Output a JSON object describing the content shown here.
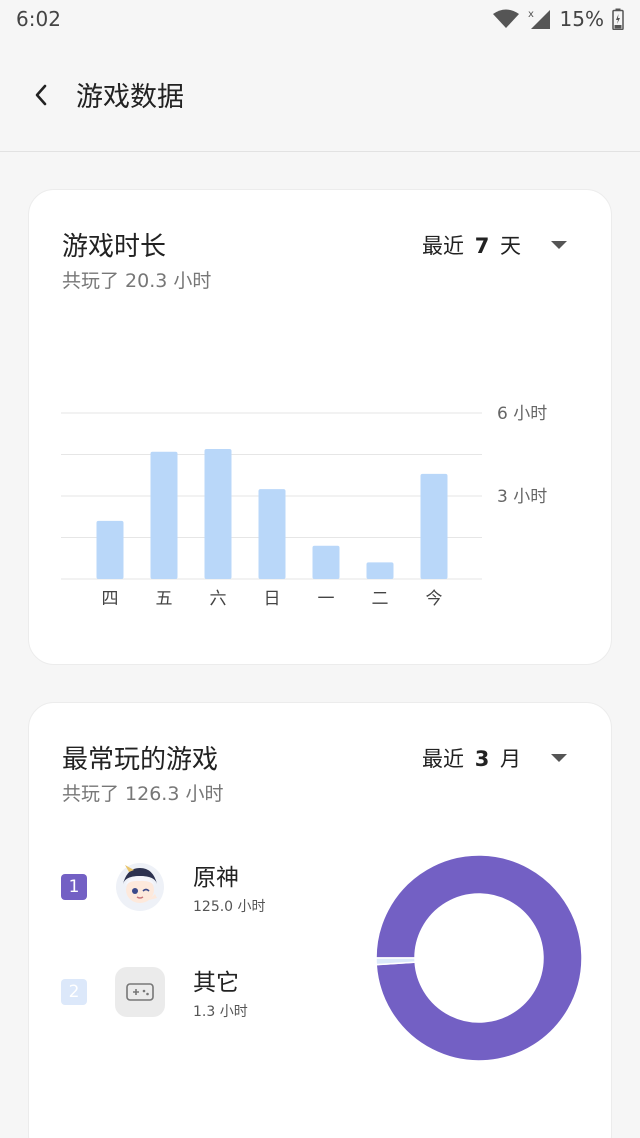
{
  "status_bar": {
    "time": "6:02",
    "battery": "15%",
    "icons": [
      "wifi-icon",
      "signal-icon",
      "battery-icon"
    ]
  },
  "header": {
    "title": "游戏数据",
    "back_icon": "chevron-left-icon"
  },
  "playtime_card": {
    "title": "游戏时长",
    "subtitle": "共玩了 20.3 小时",
    "range_label": "最近",
    "range_value": "7",
    "range_unit": "天"
  },
  "top_games_card": {
    "title": "最常玩的游戏",
    "subtitle": "共玩了 126.3 小时",
    "range_label": "最近",
    "range_value": "3",
    "range_unit": "月",
    "games": [
      {
        "rank": "1",
        "name": "原神",
        "hours": "125.0 小时",
        "icon": "genshin-avatar-icon"
      },
      {
        "rank": "2",
        "name": "其它",
        "hours": "1.3 小时",
        "icon": "gamepad-icon"
      }
    ]
  },
  "colors": {
    "bar": "#b9d7f9",
    "primary_purple": "#7360c4",
    "secondary_blue": "#dce8fa",
    "gridline": "#e6e6e6"
  },
  "chart_data": [
    {
      "type": "bar",
      "categories": [
        "四",
        "五",
        "六",
        "日",
        "一",
        "二",
        "今"
      ],
      "values": [
        2.1,
        4.6,
        4.7,
        3.25,
        1.2,
        0.6,
        3.8
      ],
      "y_ticks": [
        {
          "value": 3,
          "label": "3 小时"
        },
        {
          "value": 6,
          "label": "6 小时"
        }
      ],
      "ylim": [
        0,
        6
      ],
      "grid": true
    },
    {
      "type": "pie",
      "categories": [
        "原神",
        "其它"
      ],
      "values": [
        125.0,
        1.3
      ],
      "colors": [
        "#7360c4",
        "#dce8fa"
      ]
    }
  ]
}
